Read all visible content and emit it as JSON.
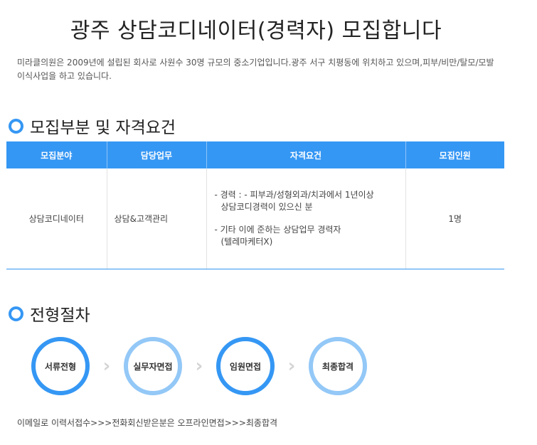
{
  "page": {
    "title": "광주 상담코디네이터(경력자) 모집합니다",
    "intro": "미라클의원은 2009년에 설립된 회사로 사원수 30명 규모의 중소기업입니다.광주 서구 치평동에 위치하고 있으며,피부/비만/탈모/모발이식사업을 하고 있습니다."
  },
  "sections": {
    "recruit": {
      "title": "모집부분 및 자격요건"
    },
    "process": {
      "title": "전형절차"
    }
  },
  "table": {
    "headers": [
      "모집분야",
      "담당업무",
      "자격요건",
      "모집인원"
    ],
    "row": {
      "field": "상담코디네이터",
      "duty": "상담&고객관리",
      "qualifications": [
        "- 경력 : - 피부과/성형외과/치과에서 1년이상",
        "상담코디경력이 있으신 분",
        "- 기타 이에 준하는 상담업무 경력자",
        "(텔레마케터X)"
      ],
      "count": "1명"
    }
  },
  "process": {
    "steps": [
      "서류전형",
      "실무자면접",
      "임원면접",
      "최종합격"
    ],
    "arrow_glyph": "›",
    "note": "이메일로 이력서접수>>>전화회신받은분은 오프라인면접>>>최종합격"
  },
  "colors": {
    "accent": "#3597f4",
    "accent_light": "#93c8f7",
    "arrow": "#d4d4d4"
  },
  "icons": {
    "section_marker": "ring-bullet-icon",
    "step_arrow": "chevron-right-icon"
  }
}
